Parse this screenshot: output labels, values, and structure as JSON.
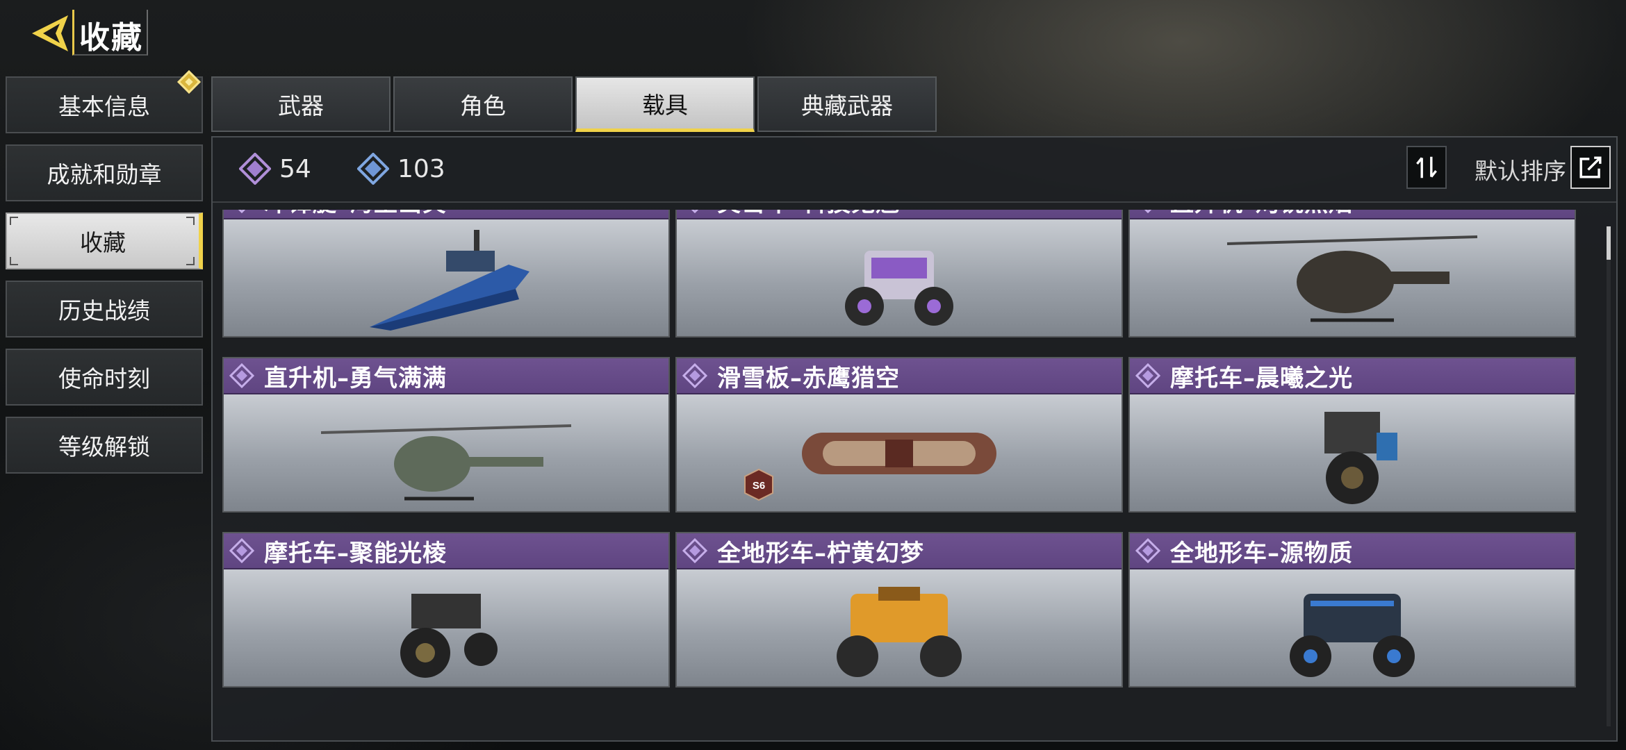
{
  "header": {
    "title": "收藏"
  },
  "sidebar": {
    "items": [
      {
        "label": "基本信息",
        "badge": true
      },
      {
        "label": "成就和勋章"
      },
      {
        "label": "收藏",
        "active": true
      },
      {
        "label": "历史战绩"
      },
      {
        "label": "使命时刻"
      },
      {
        "label": "等级解锁"
      }
    ]
  },
  "tabs": [
    {
      "label": "武器"
    },
    {
      "label": "角色"
    },
    {
      "label": "载具",
      "active": true
    },
    {
      "label": "典藏武器"
    }
  ],
  "stats": {
    "purple_count": "54",
    "blue_count": "103"
  },
  "sort": {
    "label": "默认排序"
  },
  "colors": {
    "accent": "#f0d24a",
    "rarity_purple": "#6e5290",
    "active_tab": "#e6e6e6"
  },
  "cards": [
    {
      "name": "冲锋艇–海王出笑",
      "icon": "speedboat"
    },
    {
      "name": "突击车–科技鬼魅",
      "icon": "buggy"
    },
    {
      "name": "直升机–灼锐烈焰",
      "icon": "helicopter"
    },
    {
      "name": "直升机–勇气满满",
      "icon": "helicopter"
    },
    {
      "name": "滑雪板–赤鹰猎空",
      "icon": "snowboard",
      "season_badge": "S6"
    },
    {
      "name": "摩托车–晨曦之光",
      "icon": "motorcycle-front"
    },
    {
      "name": "摩托车–聚能光棱",
      "icon": "motorcycle-side"
    },
    {
      "name": "全地形车–柠黄幻梦",
      "icon": "atv-yellow"
    },
    {
      "name": "全地形车–源物质",
      "icon": "atv-dark"
    }
  ]
}
